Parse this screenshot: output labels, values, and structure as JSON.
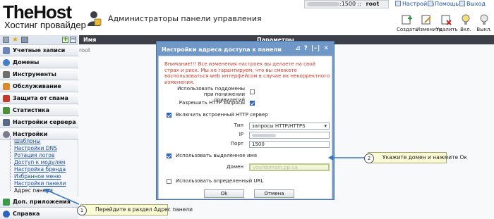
{
  "header": {
    "logo_main": "TheHost",
    "logo_sub": "Хостинг провайдер",
    "page_title": "Администраторы панели управления",
    "user_port": ":1500 ::",
    "user_name": "root",
    "links": {
      "settings": "Настройки",
      "help": "Помощь",
      "logout": "Выход"
    }
  },
  "toolbar": {
    "create": "Создать",
    "edit": "Изменить",
    "delete": "Удалить",
    "enable": "Вкл.",
    "disable": "Выкл."
  },
  "sidebar": {
    "sections": [
      {
        "label": "Учетные записи",
        "icon": "user-accounts-icon",
        "color": "#6a86b8"
      },
      {
        "label": "Домены",
        "icon": "globe-icon",
        "color": "#3f7fc8"
      },
      {
        "label": "Инструменты",
        "icon": "tools-icon",
        "color": "#6e6e6e"
      },
      {
        "label": "Обслуживание",
        "icon": "service-icon",
        "color": "#d98a2b"
      },
      {
        "label": "Защита от спама",
        "icon": "shield-icon",
        "color": "#c23b2b"
      },
      {
        "label": "Статистика",
        "icon": "chart-icon",
        "color": "#4d8f3a"
      },
      {
        "label": "Настройки сервера",
        "icon": "server-icon",
        "color": "#5b6a82"
      },
      {
        "label": "Настройки",
        "icon": "gear-icon",
        "color": "#7b7b8e"
      }
    ],
    "settings_items": [
      "Шаблоны",
      "Настройки DNS",
      "Ротация логов",
      "Доступ к модулям",
      "Настройка бренда",
      "Избранное меню",
      "Настройки панели",
      "Адрес панели"
    ],
    "bottom_sections": [
      {
        "label": "Доп. приложения",
        "icon": "addon-icon",
        "color": "#3a9a4a"
      },
      {
        "label": "Справка",
        "icon": "help-icon",
        "color": "#2e62c0"
      }
    ]
  },
  "grid": {
    "col_name": "Имя",
    "col_params": "Параметры",
    "rows": [
      "root"
    ]
  },
  "modal": {
    "title": "Настройки адреса доступа к панели",
    "controls": "⊿ ? |-| ✕",
    "warning": "Внимание!!! Все изменения настроек вы делаете на свой страх и риск. Мы не гарантируем, что вы сможете воспользоваться web интерфейсом в случае их некорректного изменения.",
    "subdomain_label": "Использовать поддомены при понижении привилегий",
    "subdomain_checked": false,
    "allow_http_label": "Разрешить HTTP запросы",
    "allow_http_checked": true,
    "builtin_server_label": "Включить встроенный HTTP сервер",
    "builtin_server_checked": true,
    "type_label": "Тип",
    "type_value": "запросы HTTP/HTTPS",
    "ip_label": "IP",
    "port_label": "Порт",
    "port_value": "1500",
    "dedicated_name_label": "Использовать выделенное имя",
    "dedicated_name_checked": true,
    "domain_label": "Домен",
    "domain_value": "yourdomain.pp.ua",
    "custom_url_label": "Использовать определенный URL",
    "custom_url_checked": false,
    "ok_label": "Ok",
    "cancel_label": "Отмена"
  },
  "callouts": [
    {
      "num": "1",
      "text": "Перейдите в раздел Адрес панели"
    },
    {
      "num": "2",
      "text": "Укажите домен и нажмите Ок"
    }
  ]
}
